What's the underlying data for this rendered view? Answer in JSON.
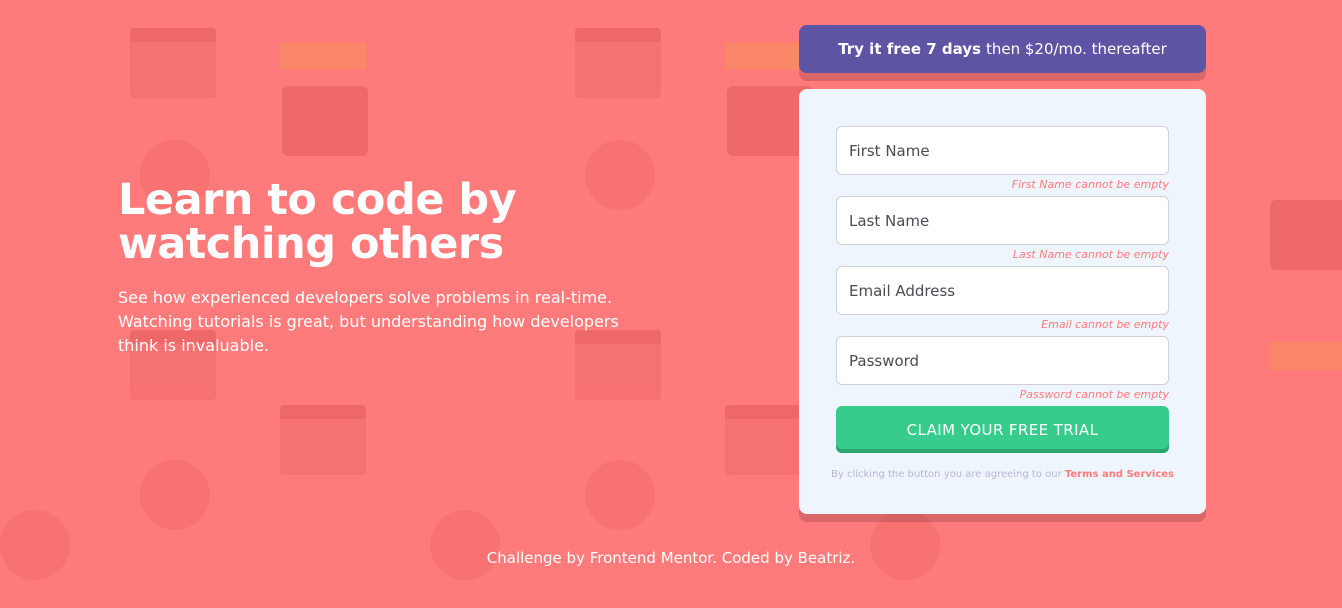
{
  "hero": {
    "title": "Learn to code by watching others",
    "description": "See how experienced developers solve problems in real-time. Watching tutorials is great, but understanding how developers think is invaluable."
  },
  "promo": {
    "bold": "Try it free 7 days",
    "rest": "then $20/mo. thereafter"
  },
  "form": {
    "fields": [
      {
        "placeholder": "First Name",
        "value": "",
        "error": "First Name cannot be empty"
      },
      {
        "placeholder": "Last Name",
        "value": "",
        "error": "Last Name cannot be empty"
      },
      {
        "placeholder": "Email Address",
        "value": "",
        "error": "Email cannot be empty"
      },
      {
        "placeholder": "Password",
        "value": "",
        "error": "Password cannot be empty"
      }
    ],
    "submit_label": "CLAIM YOUR FREE TRIAL",
    "terms_text": "By clicking the button you are agreeing to our",
    "terms_link": "Terms and Services"
  },
  "footer": {
    "text": "Challenge by Frontend Mentor. Coded by Beatriz."
  },
  "colors": {
    "background": "#ff7a7a",
    "promo": "#5e54a4",
    "submit": "#38cc8c",
    "error": "#ff7a7a"
  }
}
